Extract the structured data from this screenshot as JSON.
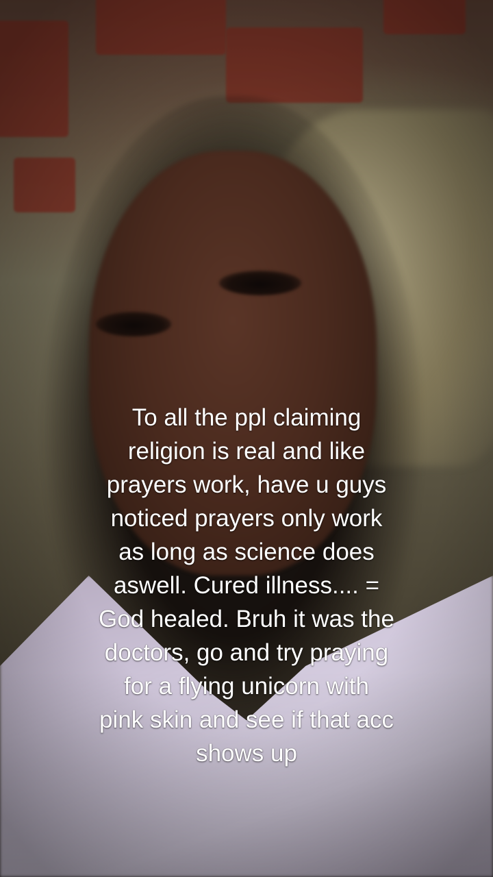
{
  "caption": {
    "text": "To all the ppl claiming\nreligion is real and like\nprayers work, have u guys\nnoticed prayers only work\nas long as science does\naswell. Cured illness.... =\nGod healed. Bruh it was the\ndoctors, go and try praying\nfor a flying unicorn with\npink skin and see if that acc\nshows up"
  },
  "colors": {
    "caption_text": "#ffffff",
    "shirt": "#d6cee0",
    "brick": "#7a2e22",
    "hair": "#15100d"
  }
}
